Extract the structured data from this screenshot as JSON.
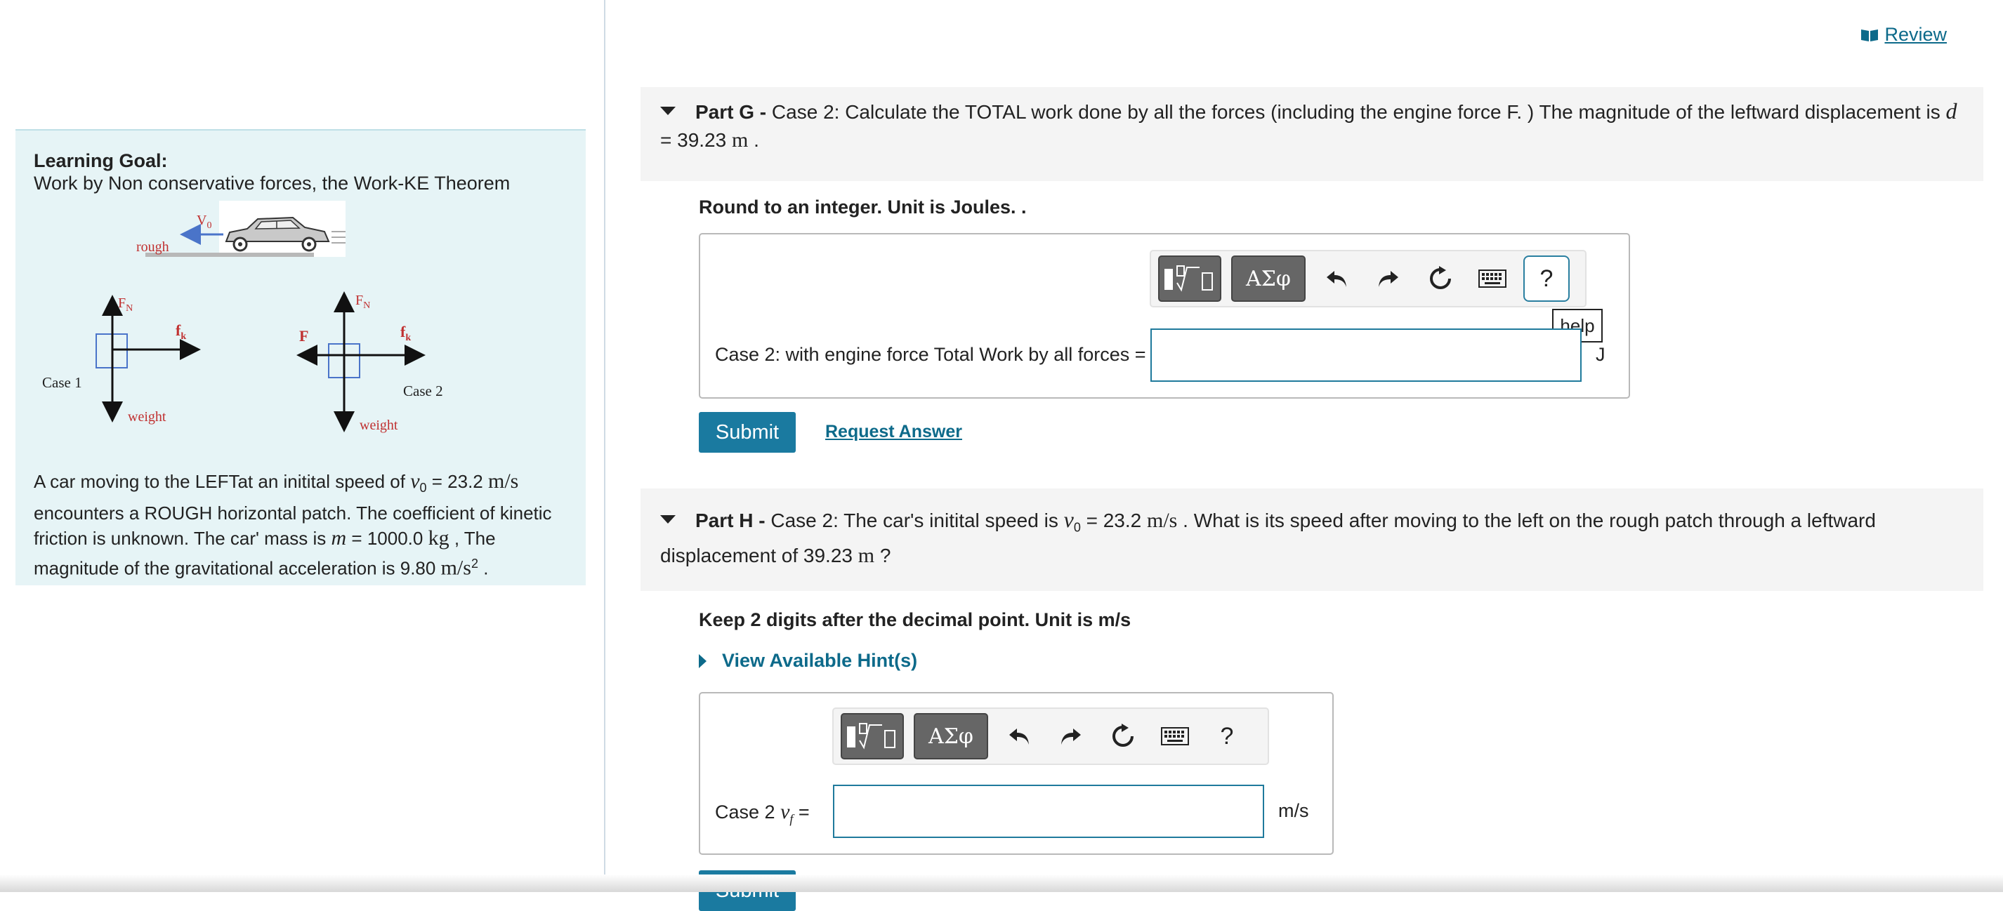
{
  "review": {
    "label": "Review"
  },
  "goal": {
    "title": "Learning Goal:",
    "subtitle": "Work by Non conservative forces, the Work-KE Theorem",
    "diagram": {
      "v0_label": "V",
      "v0_sub": "0",
      "rough_label": "rough",
      "case1": {
        "fn_label": "F",
        "fn_sub": "N",
        "fk_label": "f",
        "fk_sub": "k",
        "weight_label": "weight",
        "case_label": "Case 1"
      },
      "case2": {
        "fn_label": "F",
        "fn_sub": "N",
        "fk_label": "f",
        "fk_sub": "k",
        "f_label": "F",
        "weight_label": "weight",
        "case_label": "Case 2"
      }
    },
    "problem": {
      "p1": "A car moving to the LEFTat an initital speed of ",
      "v0_sym": "v",
      "v0_sub": "0",
      "eq1": " = 23.2 ",
      "v0_unit": "m/s",
      "p2": "encounters a ROUGH horizontal patch. The coefficient of kinetic friction is unknown. The car' mass is ",
      "m_sym": "m",
      "eq2": " = 1000.0 ",
      "m_unit": "kg",
      "p3": " , The magnitude of the gravitational acceleration is 9.80 ",
      "g_unit": "m/s",
      "g_exp": "2",
      "p4": " ."
    }
  },
  "part_g": {
    "label": "Part G -",
    "text": " Case 2: Calculate the TOTAL work done by all the forces (including the engine force F. ) The magnitude of the leftward displacement is ",
    "d_sym": "d",
    "line2": "= 39.23 ",
    "d_unit": "m",
    "line2_end": " .",
    "instruction": "Round to an integer. Unit is Joules. .",
    "field_label": "Case 2: with engine force  Total Work by all forces =",
    "unit": "J",
    "submit": "Submit",
    "request": "Request Answer",
    "help_tooltip": "help",
    "help_q": "?"
  },
  "part_h": {
    "label": "Part H -",
    "text": " Case 2: The car's initital speed is ",
    "v0_sym": "v",
    "v0_sub": "0",
    "eq": " = 23.2 ",
    "v0_unit": "m/s",
    "text2": " . What is its speed after moving to the left on the rough patch through a leftward",
    "line2": "displacement of 39.23 ",
    "d_unit": "m",
    "line2_end": " ?",
    "instruction": "Keep 2 digits after the decimal point. Unit is m/s",
    "hint": "View Available Hint(s)",
    "field_prefix": "Case 2 ",
    "vf_sym": "v",
    "vf_sub": "f",
    "field_eq": " =",
    "unit": "m/s",
    "submit": "Submit",
    "help_q": "?"
  },
  "toolbar": {
    "templates_icon": "templates-icon",
    "greek": "ΑΣφ",
    "undo_icon": "undo-icon",
    "redo_icon": "redo-icon",
    "reset_icon": "reset-icon",
    "keyboard_icon": "keyboard-icon"
  }
}
